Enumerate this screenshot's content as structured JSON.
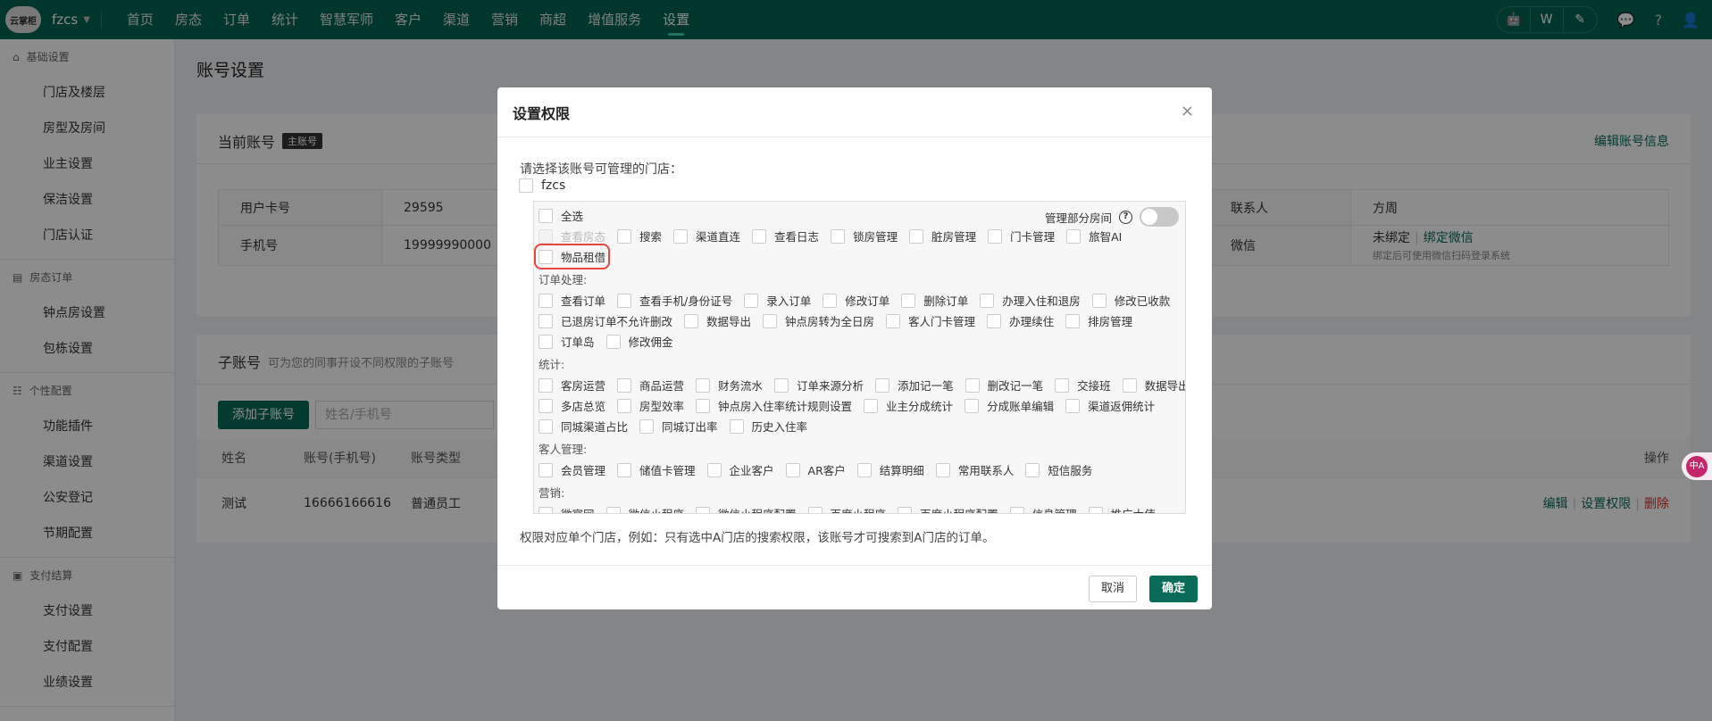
{
  "topnav": {
    "logo": "云掌柜",
    "store": "fzcs",
    "items": [
      "首页",
      "房态",
      "订单",
      "统计",
      "智慧军师",
      "客户",
      "渠道",
      "营销",
      "商超",
      "增值服务",
      "设置"
    ],
    "active": 10
  },
  "sidebar": [
    {
      "title": "基础设置",
      "items": [
        "门店及楼层",
        "房型及房间",
        "业主设置",
        "保洁设置",
        "门店认证"
      ]
    },
    {
      "title": "房态订单",
      "items": [
        "钟点房设置",
        "包栋设置"
      ]
    },
    {
      "title": "个性配置",
      "items": [
        "功能插件",
        "渠道设置",
        "公安登记",
        "节期配置"
      ]
    },
    {
      "title": "支付结算",
      "items": [
        "支付设置",
        "支付配置",
        "业绩设置"
      ]
    }
  ],
  "page": {
    "title": "账号设置"
  },
  "current": {
    "title": "当前账号",
    "badge": "主账号",
    "edit": "编辑账号信息",
    "rows": [
      {
        "l": "用户卡号",
        "v": "29595",
        "l2": "联系人",
        "v2": "方周"
      },
      {
        "l": "手机号",
        "v": "19999990000",
        "l2": "微信",
        "v2": "未绑定",
        "bind": "绑定微信",
        "hint": "绑定后可使用微信扫码登录系统"
      }
    ]
  },
  "sub": {
    "title": "子账号",
    "hint": "可为您的同事开设不同权限的子账号",
    "add": "添加子账号",
    "search_placeholder": "姓名/手机号",
    "headers": [
      "姓名",
      "账号(手机号)",
      "账号类型",
      "操作"
    ],
    "rows": [
      {
        "name": "测试",
        "phone": "16666166616",
        "type": "普通员工",
        "actions": [
          "编辑",
          "设置权限",
          "删除"
        ]
      }
    ]
  },
  "translate": "中A",
  "modal": {
    "title": "设置权限",
    "close": "×",
    "label": "请选择该账号可管理的门店：",
    "store": "fzcs",
    "manage_rooms": "管理部分房间",
    "help": "?",
    "sections": [
      {
        "label": "",
        "rows": [
          [
            "全选"
          ],
          [
            "查看房态",
            "搜索",
            "渠道直连",
            "查看日志",
            "锁房管理",
            "脏房管理",
            "门卡管理",
            "旅智AI"
          ],
          [
            "物品租借"
          ]
        ]
      },
      {
        "label": "订单处理:",
        "rows": [
          [
            "查看订单",
            "查看手机/身份证号",
            "录入订单",
            "修改订单",
            "删除订单",
            "办理入住和退房",
            "修改已收款"
          ],
          [
            "已退房订单不允许删改",
            "数据导出",
            "钟点房转为全日房",
            "客人门卡管理",
            "办理续住",
            "排房管理"
          ],
          [
            "订单岛",
            "修改佣金"
          ]
        ]
      },
      {
        "label": "统计:",
        "rows": [
          [
            "客房运营",
            "商品运营",
            "财务流水",
            "订单来源分析",
            "添加记一笔",
            "删改记一笔",
            "交接班",
            "数据导出"
          ],
          [
            "多店总览",
            "房型效率",
            "钟点房入住率统计规则设置",
            "业主分成统计",
            "分成账单编辑",
            "渠道返佣统计"
          ],
          [
            "同城渠道占比",
            "同城订出率",
            "历史入住率"
          ]
        ]
      },
      {
        "label": "客人管理:",
        "rows": [
          [
            "会员管理",
            "储值卡管理",
            "企业客户",
            "AR客户",
            "结算明细",
            "常用联系人",
            "短信服务"
          ]
        ]
      },
      {
        "label": "营销:",
        "rows": [
          [
            "微官网",
            "微信小程序",
            "微信小程序配置",
            "百度小程序",
            "百度小程序配置",
            "信息管理",
            "推广大使"
          ]
        ]
      }
    ],
    "note": "权限对应单个门店，例如：只有选中A门店的搜索权限，该账号才可搜索到A门店的订单。",
    "cancel": "取消",
    "ok": "确定"
  }
}
